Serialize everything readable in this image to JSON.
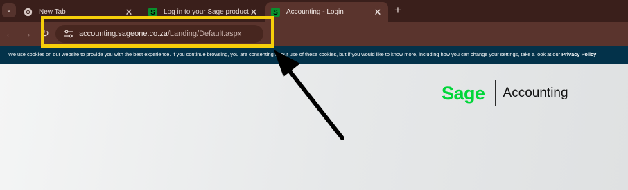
{
  "browser": {
    "tabs": [
      {
        "title": "New Tab",
        "icon": "chrome-icon",
        "active": false
      },
      {
        "title": "Log in to your Sage product | S",
        "icon": "sage-s-icon",
        "active": false
      },
      {
        "title": "Accounting - Login",
        "icon": "sage-s-icon",
        "active": true
      }
    ],
    "tab_close_glyph": "✕",
    "new_tab_glyph": "+",
    "tab_search_glyph": "⌄",
    "url": {
      "domain": "accounting.sageone.co.za",
      "path": "/Landing/Default.aspx"
    },
    "colors": {
      "tabstrip": "#3a1f1b",
      "toolbar": "#5a342d",
      "omnibox": "#47261f"
    }
  },
  "cookie_banner": {
    "text": "We use cookies on our website to provide you with the best experience. If you continue browsing, you are consenting to our use of these cookies, but if you would like to know more, including how you can change your settings, take a look at our ",
    "link": "Privacy Policy",
    "background": "#03324a"
  },
  "brand": {
    "logo": "Sage",
    "product": "Accounting",
    "logo_color": "#00d639"
  },
  "annotation": {
    "highlight_color": "#f6cf0a",
    "arrow_color": "#000000"
  }
}
